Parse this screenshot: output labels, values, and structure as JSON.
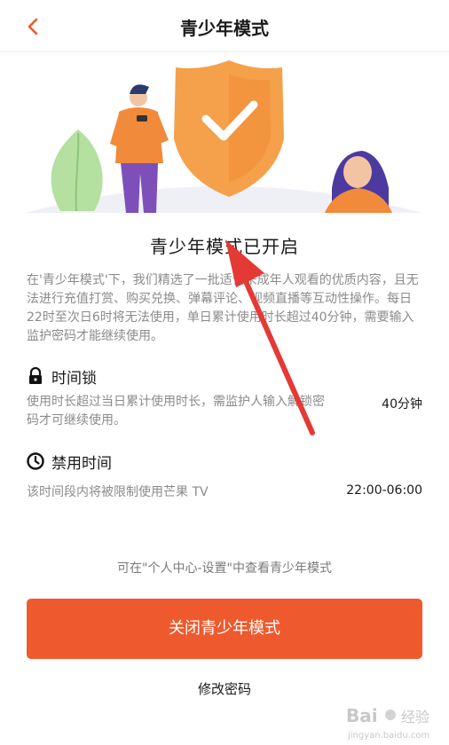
{
  "header": {
    "title": "青少年模式"
  },
  "main": {
    "title": "青少年模式已开启",
    "description": "在'青少年模式'下，我们精选了一批适合未成年人观看的优质内容，且无法进行充值打赏、购买兑换、弹幕评论、视频直播等互动性操作。每日22时至次日6时将无法使用，单日累计使用时长超过40分钟，需要输入监护密码才能继续使用。"
  },
  "time_lock": {
    "label": "时间锁",
    "description": "使用时长超过当日累计使用时长，需监护人输入解锁密码才可继续使用。",
    "value": "40分钟"
  },
  "ban_time": {
    "label": "禁用时间",
    "description": "该时间段内将被限制使用芒果 TV",
    "value": "22:00-06:00"
  },
  "note": "可在\"个人中心-设置\"中查看青少年模式",
  "buttons": {
    "close": "关闭青少年模式",
    "change_password": "修改密码"
  },
  "colors": {
    "accent": "#ee5a2d",
    "shield": "#f5a04a",
    "arrow": "#e53935"
  },
  "watermark": {
    "logo_text": "Bai",
    "sub_text": "经验",
    "domain": "jingyan.baidu.com"
  }
}
